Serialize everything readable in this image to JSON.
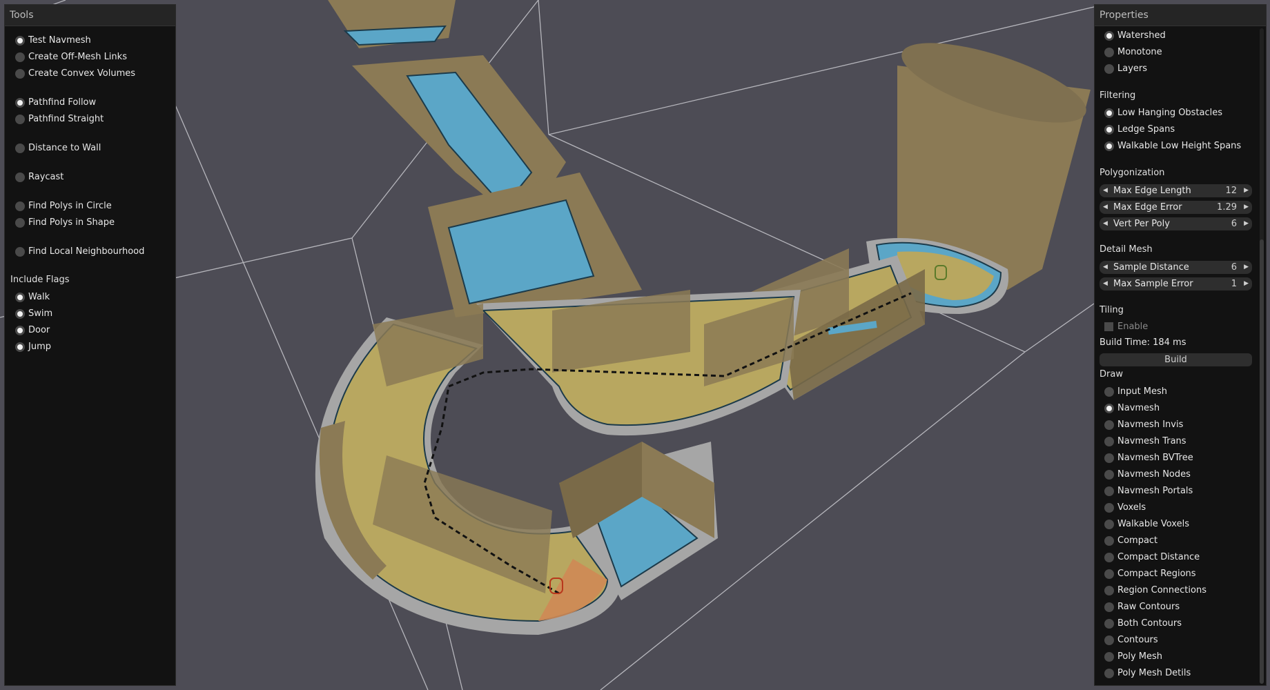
{
  "colors": {
    "background": "#4d4c55",
    "wall": "#8b7a55",
    "navmesh_blue": "#5ba6c7",
    "navmesh_yellow": "#b8a760",
    "panel": "#121212"
  },
  "tools": {
    "title": "Tools",
    "items": [
      {
        "label": "Test Navmesh",
        "selected": true
      },
      {
        "label": "Create Off-Mesh Links",
        "selected": false
      },
      {
        "label": "Create Convex Volumes",
        "selected": false
      },
      {
        "label": "Pathfind Follow",
        "selected": true
      },
      {
        "label": "Pathfind Straight",
        "selected": false
      },
      {
        "label": "Distance to Wall",
        "selected": false
      },
      {
        "label": "Raycast",
        "selected": false
      },
      {
        "label": "Find Polys in Circle",
        "selected": false
      },
      {
        "label": "Find Polys in Shape",
        "selected": false
      },
      {
        "label": "Find Local Neighbourhood",
        "selected": false
      }
    ],
    "include_flags_label": "Include Flags",
    "flags": [
      {
        "label": "Walk",
        "selected": true
      },
      {
        "label": "Swim",
        "selected": true
      },
      {
        "label": "Door",
        "selected": true
      },
      {
        "label": "Jump",
        "selected": true
      }
    ]
  },
  "properties": {
    "title": "Properties",
    "partition": [
      {
        "label": "Watershed",
        "selected": true
      },
      {
        "label": "Monotone",
        "selected": false
      },
      {
        "label": "Layers",
        "selected": false
      }
    ],
    "filtering_label": "Filtering",
    "filtering": [
      {
        "label": "Low Hanging Obstacles",
        "selected": true
      },
      {
        "label": "Ledge Spans",
        "selected": true
      },
      {
        "label": "Walkable Low Height Spans",
        "selected": true
      }
    ],
    "polygonization_label": "Polygonization",
    "polygonization": [
      {
        "label": "Max Edge Length",
        "value": "12"
      },
      {
        "label": "Max Edge Error",
        "value": "1.29"
      },
      {
        "label": "Vert Per Poly",
        "value": "6"
      }
    ],
    "detail_mesh_label": "Detail Mesh",
    "detail_mesh": [
      {
        "label": "Sample Distance",
        "value": "6"
      },
      {
        "label": "Max Sample Error",
        "value": "1"
      }
    ],
    "tiling_label": "Tiling",
    "enable_label": "Enable",
    "build_time": "Build Time: 184 ms",
    "build_label": "Build",
    "draw_label": "Draw",
    "draw": [
      {
        "label": "Input Mesh",
        "selected": false
      },
      {
        "label": "Navmesh",
        "selected": true
      },
      {
        "label": "Navmesh Invis",
        "selected": false
      },
      {
        "label": "Navmesh Trans",
        "selected": false
      },
      {
        "label": "Navmesh BVTree",
        "selected": false
      },
      {
        "label": "Navmesh Nodes",
        "selected": false
      },
      {
        "label": "Navmesh Portals",
        "selected": false
      },
      {
        "label": "Voxels",
        "selected": false
      },
      {
        "label": "Walkable Voxels",
        "selected": false
      },
      {
        "label": "Compact",
        "selected": false
      },
      {
        "label": "Compact Distance",
        "selected": false
      },
      {
        "label": "Compact Regions",
        "selected": false
      },
      {
        "label": "Region Connections",
        "selected": false
      },
      {
        "label": "Raw Contours",
        "selected": false
      },
      {
        "label": "Both Contours",
        "selected": false
      },
      {
        "label": "Contours",
        "selected": false
      },
      {
        "label": "Poly Mesh",
        "selected": false
      },
      {
        "label": "Poly Mesh Detils",
        "selected": false
      }
    ]
  }
}
